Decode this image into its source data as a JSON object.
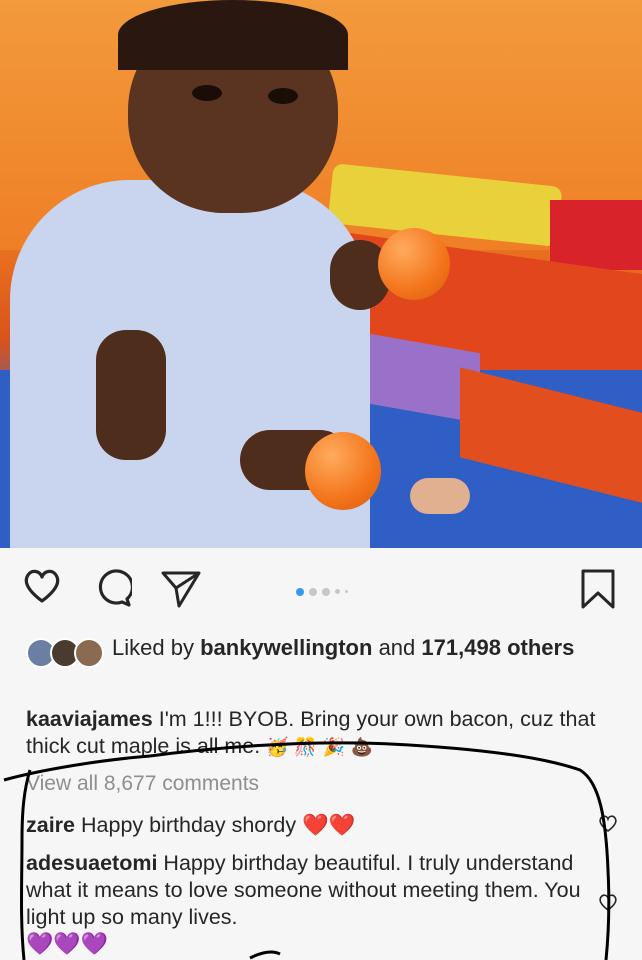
{
  "post": {
    "image_alt": "toddler in light blue dress holding orange balls",
    "carousel": {
      "total": 5,
      "active": 1
    },
    "icons": [
      "heart-icon",
      "comment-icon",
      "share-icon",
      "bookmark-icon"
    ]
  },
  "likes": {
    "prefix": "Liked by",
    "user": "bankywellington",
    "middle": "and",
    "count": "171,498",
    "suffix": "others"
  },
  "caption": {
    "username": "kaaviajames",
    "text": "I'm 1!!! BYOB. Bring your own bacon, cuz that thick cut maple is all me.",
    "emojis": "🥳 🎊 🎉 💩"
  },
  "view_all": "View all 8,677 comments",
  "comments": [
    {
      "username": "zaire",
      "text": "Happy birthday shordy",
      "emojis": "❤️❤️"
    },
    {
      "username": "adesuaetomi",
      "text": "Happy birthday beautiful. I truly understand what it means to love someone without meeting them. You light up so many lives.",
      "emojis": "💜💜💜"
    }
  ],
  "colors": {
    "accent": "#3897f0",
    "annotation": "#000000"
  }
}
